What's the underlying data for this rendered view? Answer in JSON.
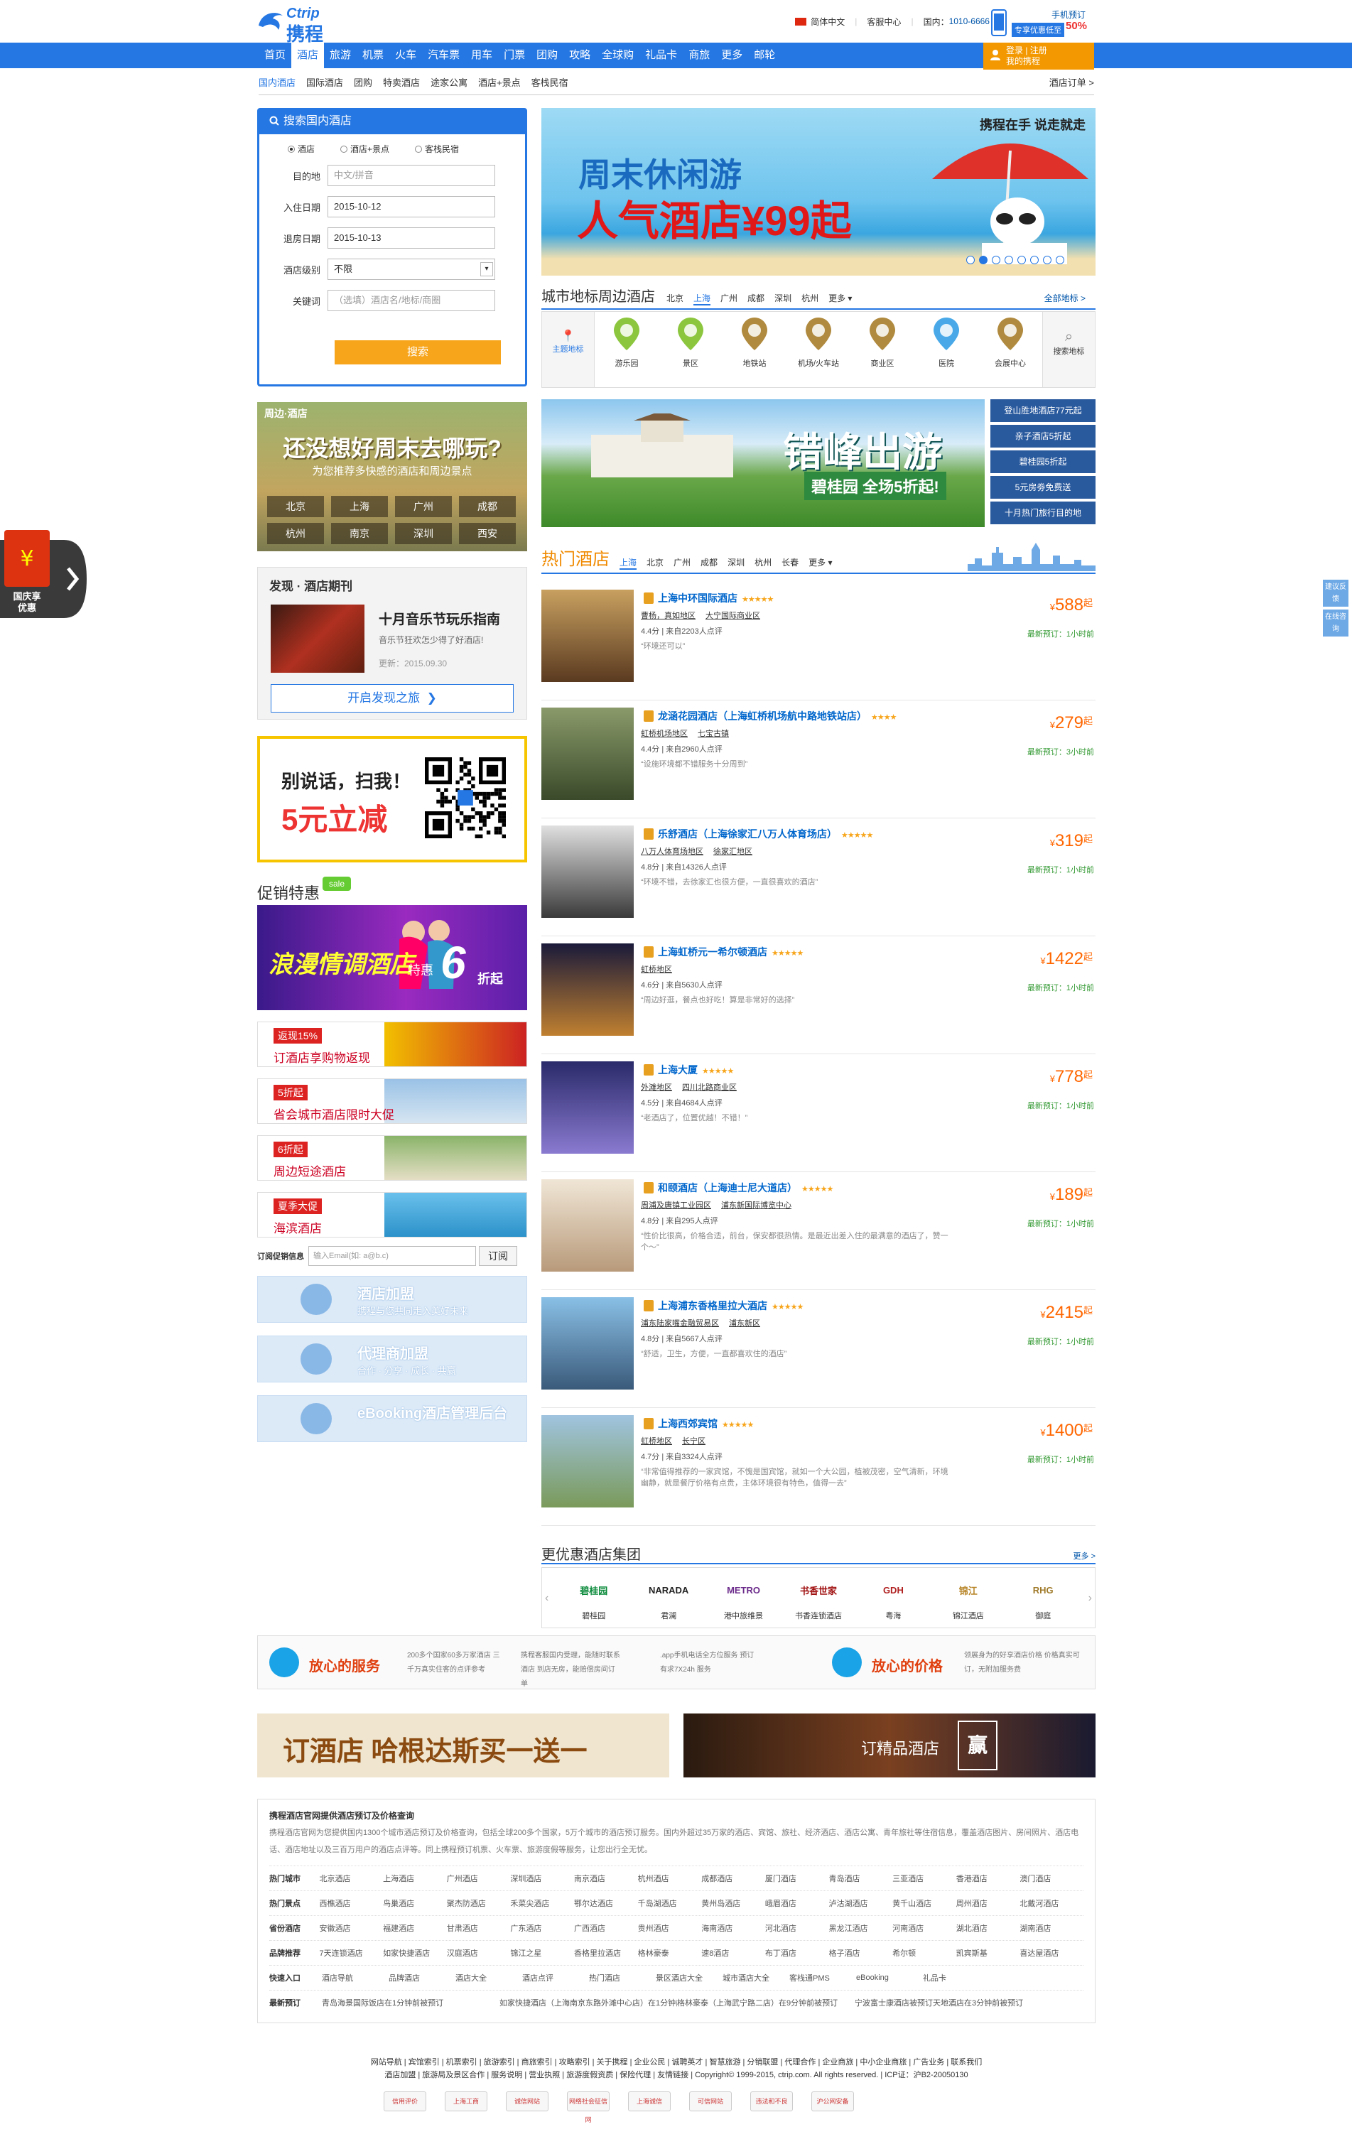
{
  "header": {
    "logo_en": "Ctrip",
    "logo_cn": "携程",
    "lang": "简体中文",
    "service": "客服中心",
    "hotline_label": "国内：",
    "hotline": "1010-6666",
    "mobile_title": "手机预订",
    "mobile_promo": "专享优惠低至",
    "mobile_pct": "50%"
  },
  "nav": {
    "items": [
      "首页",
      "酒店",
      "旅游",
      "机票",
      "火车",
      "汽车票",
      "用车",
      "门票",
      "团购",
      "攻略",
      "全球购",
      "礼品卡",
      "商旅",
      "更多",
      "邮轮"
    ],
    "login_line1": "登录 | 注册",
    "login_line2": "我的携程"
  },
  "subnav": {
    "items": [
      "国内酒店",
      "国际酒店",
      "团购",
      "特卖酒店",
      "途家公寓",
      "酒店+景点",
      "客栈民宿"
    ],
    "orders": "酒店订单 >"
  },
  "search": {
    "title": "搜索国内酒店",
    "types": [
      "酒店",
      "酒店+景点",
      "客栈民宿"
    ],
    "labels": [
      "目的地",
      "入住日期",
      "退房日期",
      "酒店级别",
      "关键词"
    ],
    "dest_placeholder": "中文/拼音",
    "checkin": "2015-10-12",
    "checkout": "2015-10-13",
    "level": "不限",
    "keyword_placeholder": "（选填）酒店名/地标/商圈",
    "button": "搜索"
  },
  "weekend": {
    "label": "周边·酒店",
    "title": "还没想好周末去哪玩?",
    "subtitle": "为您推荐多快感的酒店和周边景点",
    "cities": [
      "北京",
      "上海",
      "广州",
      "成都",
      "杭州",
      "南京",
      "深圳",
      "西安"
    ]
  },
  "discover": {
    "header": "发现 · 酒店期刊",
    "title": "十月音乐节玩乐指南",
    "desc": "音乐节狂欢怎少得了好酒店!",
    "date": "更新：2015.09.30",
    "button": "开启发现之旅",
    "button_arrow": "❯"
  },
  "qr": {
    "line1": "别说话，扫我！",
    "line2": "5元立减"
  },
  "promo": {
    "title": "促销特惠",
    "sale_tag": "sale",
    "romance_line": "浪漫情调酒店",
    "romance_lead": "特惠",
    "romance_num": "6",
    "romance_tail": "折起",
    "minis": [
      {
        "tag": "返现15%",
        "text": "订酒店享购物返现"
      },
      {
        "tag": "5折起",
        "text": "省会城市酒店限时大促"
      },
      {
        "tag": "6折起",
        "text": "周边短途酒店"
      },
      {
        "tag": "夏季大促",
        "text": "海滨酒店"
      }
    ]
  },
  "subscribe": {
    "label": "订阅促销信息",
    "placeholder": "输入Email(如: a@b.c)",
    "button": "订阅"
  },
  "joins": [
    {
      "title": "酒店加盟",
      "sub": "携程与您共同走入美好未来"
    },
    {
      "title": "代理商加盟",
      "sub": "合作 · 分享 · 成长 · 共赢"
    },
    {
      "title": "eBooking酒店管理后台",
      "sub": ""
    }
  ],
  "banner": {
    "line1": "周末休闲游",
    "line2": "人气酒店¥99起",
    "corner": "携程在手 说走就走",
    "dots": 8,
    "active_dot": 1
  },
  "landmarks": {
    "title": "城市地标周边酒店",
    "cities": [
      "北京",
      "上海",
      "广州",
      "成都",
      "深圳",
      "杭州",
      "更多 ▾"
    ],
    "more": "全部地标 >",
    "left": "主题地标",
    "right": "搜索地标",
    "icons": [
      {
        "label": "游乐园",
        "color": "#8cc63f"
      },
      {
        "label": "景区",
        "color": "#8cc63f"
      },
      {
        "label": "地铁站",
        "color": "#b08a3e"
      },
      {
        "label": "机场/火车站",
        "color": "#b08a3e"
      },
      {
        "label": "商业区",
        "color": "#b08a3e"
      },
      {
        "label": "医院",
        "color": "#49a9e8"
      },
      {
        "label": "会展中心",
        "color": "#b08a3e"
      }
    ]
  },
  "offpeak": {
    "title": "错峰出游",
    "sub": "碧桂园 全场5折起!",
    "links": [
      "登山胜地酒店77元起",
      "亲子酒店5折起",
      "碧桂园5折起",
      "5元房劵免费送",
      "十月热门旅行目的地"
    ]
  },
  "hot": {
    "title": "热门酒店",
    "cities": [
      "上海",
      "北京",
      "广州",
      "成都",
      "深圳",
      "杭州",
      "长春",
      "更多 ▾"
    ],
    "hotels": [
      {
        "name": "上海中环国际酒店",
        "stars": "★★★★★",
        "areas": [
          "曹杨，真如地区",
          "大宁国际商业区"
        ],
        "score": "4.4分",
        "reviews": "来自2203人点评",
        "comment": "“环境还可以”",
        "price": "588",
        "booked": "最新预订：1小时前"
      },
      {
        "name": "龙涵花园酒店（上海虹桥机场航中路地铁站店）",
        "stars": "★★★★",
        "areas": [
          "虹桥机场地区",
          "七宝古镇"
        ],
        "score": "4.4分",
        "reviews": "来自2960人点评",
        "comment": "“设施环境都不错服务十分周到”",
        "price": "279",
        "booked": "最新预订：3小时前"
      },
      {
        "name": "乐舒酒店（上海徐家汇八万人体育场店）",
        "stars": "★★★★★",
        "areas": [
          "八万人体育场地区",
          "徐家汇地区"
        ],
        "score": "4.8分",
        "reviews": "来自14326人点评",
        "comment": "“环境不错，去徐家汇也很方便，一直很喜欢的酒店”",
        "price": "319",
        "booked": "最新预订：1小时前"
      },
      {
        "name": "上海虹桥元一希尔顿酒店",
        "stars": "★★★★★",
        "areas": [
          "虹桥地区"
        ],
        "score": "4.6分",
        "reviews": "来自5630人点评",
        "comment": "“周边好逛，餐点也好吃！算是非常好的选择”",
        "price": "1422",
        "booked": "最新预订：1小时前"
      },
      {
        "name": "上海大厦",
        "stars": "★★★★★",
        "areas": [
          "外滩地区",
          "四川北路商业区"
        ],
        "score": "4.5分",
        "reviews": "来自4684人点评",
        "comment": "“老酒店了，位置优越！不错！”",
        "price": "778",
        "booked": "最新预订：1小时前"
      },
      {
        "name": "和颐酒店（上海迪士尼大道店）",
        "stars": "★★★★★",
        "areas": [
          "周浦及唐镇工业园区",
          "浦东新国际博览中心"
        ],
        "score": "4.8分",
        "reviews": "来自295人点评",
        "comment": "“性价比很高，价格合适，前台，保安都很热情。是最近出差入住的最满意的酒店了，赞一个～”",
        "price": "189",
        "booked": "最新预订：1小时前"
      },
      {
        "name": "上海浦东香格里拉大酒店",
        "stars": "★★★★★",
        "areas": [
          "浦东陆家嘴金融贸易区",
          "浦东新区"
        ],
        "score": "4.8分",
        "reviews": "来自5667人点评",
        "comment": "“舒适，卫生，方便，一直都喜欢住的酒店”",
        "price": "2415",
        "booked": "最新预订：1小时前"
      },
      {
        "name": "上海西郊宾馆",
        "stars": "★★★★★",
        "areas": [
          "虹桥地区",
          "长宁区"
        ],
        "score": "4.7分",
        "reviews": "来自3324人点评",
        "comment": "“非常值得推荐的一家宾馆，不愧是国宾馆，就如一个大公园，植被茂密，空气清新，环境幽静，就是餐厅价格有点贵，主体环境很有特色，值得一去”",
        "price": "1400",
        "booked": "最新预订：1小时前"
      }
    ],
    "price_prefix": "¥",
    "price_suffix": "起"
  },
  "groups": {
    "title": "更优惠酒店集团",
    "more": "更多 >",
    "items": [
      {
        "logo": "碧桂园",
        "name": "碧桂园",
        "color": "#0a8a3a"
      },
      {
        "logo": "NARADA",
        "name": "君澜",
        "color": "#222"
      },
      {
        "logo": "METRO",
        "name": "港中旅维景",
        "color": "#6a2a8a"
      },
      {
        "logo": "书香世家",
        "name": "书香连锁酒店",
        "color": "#a01010"
      },
      {
        "logo": "GDH",
        "name": "粤海",
        "color": "#b02020"
      },
      {
        "logo": "锦江",
        "name": "锦江酒店",
        "color": "#b8862a"
      },
      {
        "logo": "RHG",
        "name": "御庭",
        "color": "#a07a2a"
      }
    ]
  },
  "services": {
    "left_title": "放心的服务",
    "right_title": "放心的价格",
    "texts": [
      "200多个国家60多万家酒店 三千万真实住客的点评参考",
      "携程客服国内受理，能随时联系酒店 到店无房，能赔偿房间订单",
      ".app手机电话全方位服务 预订有求7X24h 服务",
      "领展身为的好享酒店价格 价格真实可订，无附加服务费"
    ]
  },
  "ads": {
    "left": "订酒店 哈根达斯买一送一",
    "right": "订精品酒店",
    "right_badge": "赢"
  },
  "seo": {
    "title": "携程酒店官网提供酒店预订及价格查询",
    "intro": "携程酒店官网为您提供国内1300个城市酒店预订及价格查询，包括全球200多个国家，5万个城市的酒店预订服务。国内外超过35万家的酒店、宾馆、旅社、经济酒店、酒店公寓、青年旅社等住宿信息，覆盖酒店图片、房间照片、酒店电话、酒店地址以及三百万用户的酒店点评等。同上携程预订机票、火车票、旅游度假等服务，让您出行全无忧。",
    "rows": [
      {
        "label": "热门城市",
        "items": [
          "北京酒店",
          "上海酒店",
          "广州酒店",
          "深圳酒店",
          "南京酒店",
          "杭州酒店",
          "成都酒店",
          "厦门酒店",
          "青岛酒店",
          "三亚酒店",
          "香港酒店",
          "澳门酒店"
        ]
      },
      {
        "label": "热门景点",
        "items": [
          "西樵酒店",
          "鸟巢酒店",
          "聚杰防酒店",
          "禾菜尖酒店",
          "鄂尔达酒店",
          "千岛湖酒店",
          "黄州岛酒店",
          "峨眉酒店",
          "泸沽湖酒店",
          "黄千山酒店",
          "周州酒店",
          "北戴河酒店"
        ]
      },
      {
        "label": "省份酒店",
        "items": [
          "安徽酒店",
          "福建酒店",
          "甘肃酒店",
          "广东酒店",
          "广西酒店",
          "贵州酒店",
          "海南酒店",
          "河北酒店",
          "黑龙江酒店",
          "河南酒店",
          "湖北酒店",
          "湖南酒店"
        ]
      },
      {
        "label": "品牌推荐",
        "items": [
          "7天连锁酒店",
          "如家快捷酒店",
          "汉庭酒店",
          "锦江之星",
          "香格里拉酒店",
          "格林豪泰",
          "速8酒店",
          "布丁酒店",
          "格子酒店",
          "希尔顿",
          "凯宾斯基",
          "喜达屋酒店"
        ]
      },
      {
        "label": "快速入口",
        "items": [
          "酒店导航",
          "品牌酒店",
          "酒店大全",
          "酒店点评",
          "热门酒店",
          "景区酒店大全",
          "城市酒店大全",
          "客栈通PMS",
          "eBooking",
          "礼品卡"
        ]
      },
      {
        "label": "最新预订",
        "items": [
          "青岛海景国际饭店在1分钟前被预订",
          "如家快捷酒店（上海南京东路外滩中心店）在1分钟前被预订",
          "格林豪泰（上海武宁路二店）在9分钟前被预订",
          "宁波富士康酒店被预订天地酒店在3分钟前被预订"
        ]
      }
    ]
  },
  "footer": {
    "line1": "网站导航 | 宾馆索引 | 机票索引 | 旅游索引 | 商旅索引 | 攻略索引 | 关于携程 | 企业公民 | 诚聘英才 | 智慧旅游 | 分销联盟 | 代理合作 | 企业商旅 | 中小企业商旅 | 广告业务 | 联系我们",
    "line2": "酒店加盟 | 旅游局及景区合作 | 服务说明 | 营业执照 | 旅游度假资质 | 保险代理 | 友情链接 | Copyright© 1999-2015, ctrip.com. All rights reserved. | ICP证：沪B2-20050130",
    "badges": [
      "信用评价",
      "上海工商",
      "诚信网站",
      "网络社会征信网",
      "上海诚信",
      "可信网站",
      "违法和不良",
      "沪公网安备"
    ]
  },
  "float": {
    "national": "国庆享优惠",
    "feedback": [
      "建议反馈",
      "在线咨询"
    ]
  }
}
